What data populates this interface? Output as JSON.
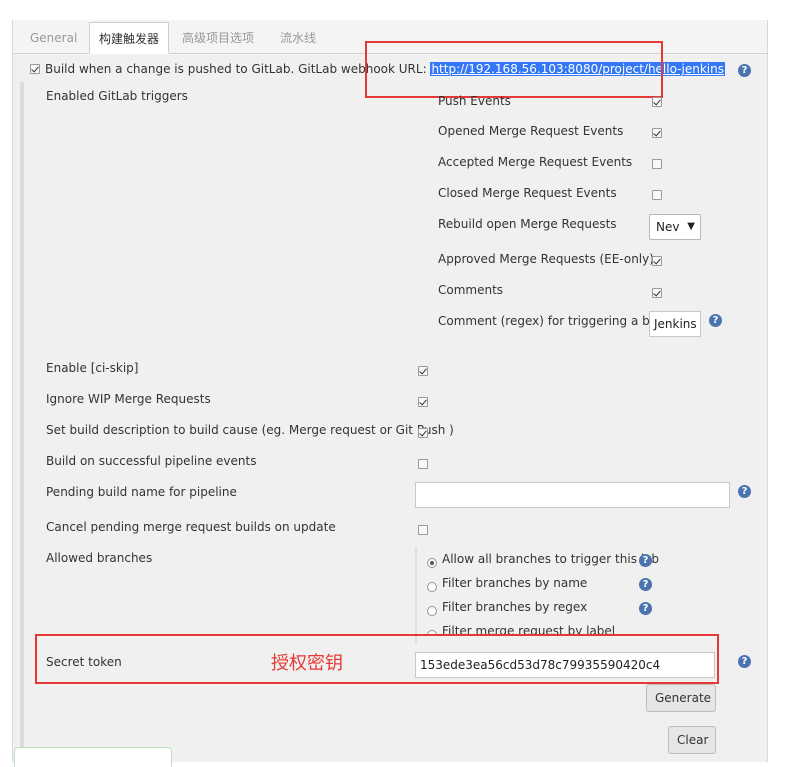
{
  "tabs": [
    {
      "label": "General"
    },
    {
      "label": "构建触发器"
    },
    {
      "label": "高级项目选项"
    },
    {
      "label": "流水线"
    }
  ],
  "trigger": {
    "label": "Build when a change is pushed to GitLab. GitLab webhook URL:",
    "url": "http://192.168.56.103:8080/project/hello-jenkins"
  },
  "gitlab_triggers": {
    "label": "Enabled GitLab triggers",
    "items": [
      {
        "label": "Push Events"
      },
      {
        "label": "Opened Merge Request Events"
      },
      {
        "label": "Accepted Merge Request Events"
      },
      {
        "label": "Closed Merge Request Events"
      },
      {
        "label": "Rebuild open Merge Requests",
        "select_value": "Nev"
      },
      {
        "label": "Approved Merge Requests (EE-only)"
      },
      {
        "label": "Comments"
      },
      {
        "label": "Comment (regex) for triggering a build",
        "input_value": "Jenkins"
      }
    ]
  },
  "options": [
    {
      "label": "Enable [ci-skip]"
    },
    {
      "label": "Ignore WIP Merge Requests"
    },
    {
      "label": "Set build description to build cause (eg. Merge request or Git Push )"
    },
    {
      "label": "Build on successful pipeline events"
    },
    {
      "label": "Pending build name for pipeline",
      "input_value": ""
    },
    {
      "label": "Cancel pending merge request builds on update"
    }
  ],
  "branches": {
    "label": "Allowed branches",
    "choices": [
      {
        "label": "Allow all branches to trigger this job"
      },
      {
        "label": "Filter branches by name"
      },
      {
        "label": "Filter branches by regex"
      },
      {
        "label": "Filter merge request by label"
      }
    ]
  },
  "secret": {
    "label": "Secret token",
    "annotation": "授权密钥",
    "value": "153ede3ea56cd53d78c79935590420c4",
    "generate_label": "Generate",
    "clear_label": "Clear"
  },
  "colors": {
    "highlight_red": "#e53935",
    "url_selection": "#3478f6",
    "help_blue": "#4a74b0"
  }
}
